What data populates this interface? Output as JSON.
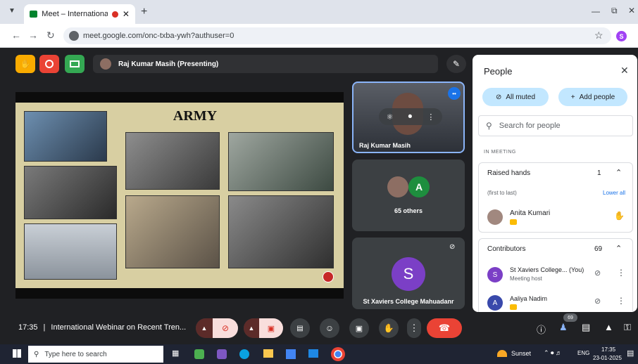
{
  "browser": {
    "tab_title": "Meet – International Webin",
    "url": "meet.google.com/onc-txba-ywh?authuser=0",
    "profile_initial": "S",
    "new_tab": "+"
  },
  "meet": {
    "presenter_label": "Raj Kumar Masih (Presenting)",
    "slide_title": "ARMY",
    "main_tile_name": "Raj Kumar Masih",
    "others_tile_initial": "A",
    "others_label": "65 others",
    "host_initial": "S",
    "host_tile_name": "St Xaviers College Mahuadanr",
    "time": "17:35",
    "meeting_title": "International Webinar on Recent Tren...",
    "people_badge": "69"
  },
  "people": {
    "title": "People",
    "all_muted": "All muted",
    "add_people": "Add people",
    "search_placeholder": "Search for people",
    "in_meeting": "IN MEETING",
    "raised_hands_label": "Raised hands",
    "raised_hands_count": "1",
    "first_to_last": "(first to last)",
    "lower_all": "Lower all",
    "raised_person": "Anita Kumari",
    "contributors_label": "Contributors",
    "contributors_count": "69",
    "contributor1": "St Xaviers College... (You)",
    "contributor1_role": "Meeting host",
    "contributor1_initial": "S",
    "contributor2": "Aaliya Nadim",
    "contributor2_initial": "A"
  },
  "taskbar": {
    "search_placeholder": "Type here to search",
    "weather": "Sunset",
    "lang": "ENG",
    "clock_time": "17:35",
    "clock_date": "23-01-2025"
  },
  "colors": {
    "meet_red": "#ea4335",
    "accent_blue": "#1a73e8",
    "avatar_purple": "#7b3fc6",
    "avatar_green": "#1e8e3e"
  }
}
